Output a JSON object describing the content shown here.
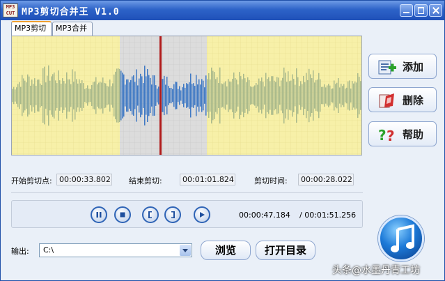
{
  "window": {
    "title": "MP3剪切合并王 V1.0",
    "logo_text": "MP3 CUT",
    "controls": [
      "minimize",
      "maximize",
      "close"
    ]
  },
  "tabs": [
    {
      "label": "MP3剪切",
      "active": true
    },
    {
      "label": "MP3合并",
      "active": false
    }
  ],
  "waveform": {
    "background_color": "#f7f0a8",
    "selection_color": "#dcdcdc",
    "wave_color": "#a9b98b",
    "selected_wave_color": "#3f79c4",
    "cursor_color": "#b01a1a"
  },
  "side_buttons": [
    {
      "label": "添加",
      "icon": "add-icon"
    },
    {
      "label": "删除",
      "icon": "delete-icon"
    },
    {
      "label": "帮助",
      "icon": "help-icon"
    }
  ],
  "times": {
    "start_label": "开始剪切点:",
    "start_value": "00:00:33.802",
    "end_label": "结束剪切:",
    "end_value": "00:01:01.824",
    "duration_label": "剪切时间:",
    "duration_value": "00:00:28.022"
  },
  "player": {
    "buttons": [
      "pause-icon",
      "stop-icon",
      "mark-start-icon",
      "mark-end-icon",
      "play-selection-icon"
    ],
    "current_time": "00:00:47.184",
    "total_time": "/ 00:01:51.256"
  },
  "output": {
    "label": "输出:",
    "path": "C:\\",
    "browse_label": "浏览",
    "open_dir_label": "打开目录"
  },
  "watermark": "头条@水墨丹青工坊"
}
